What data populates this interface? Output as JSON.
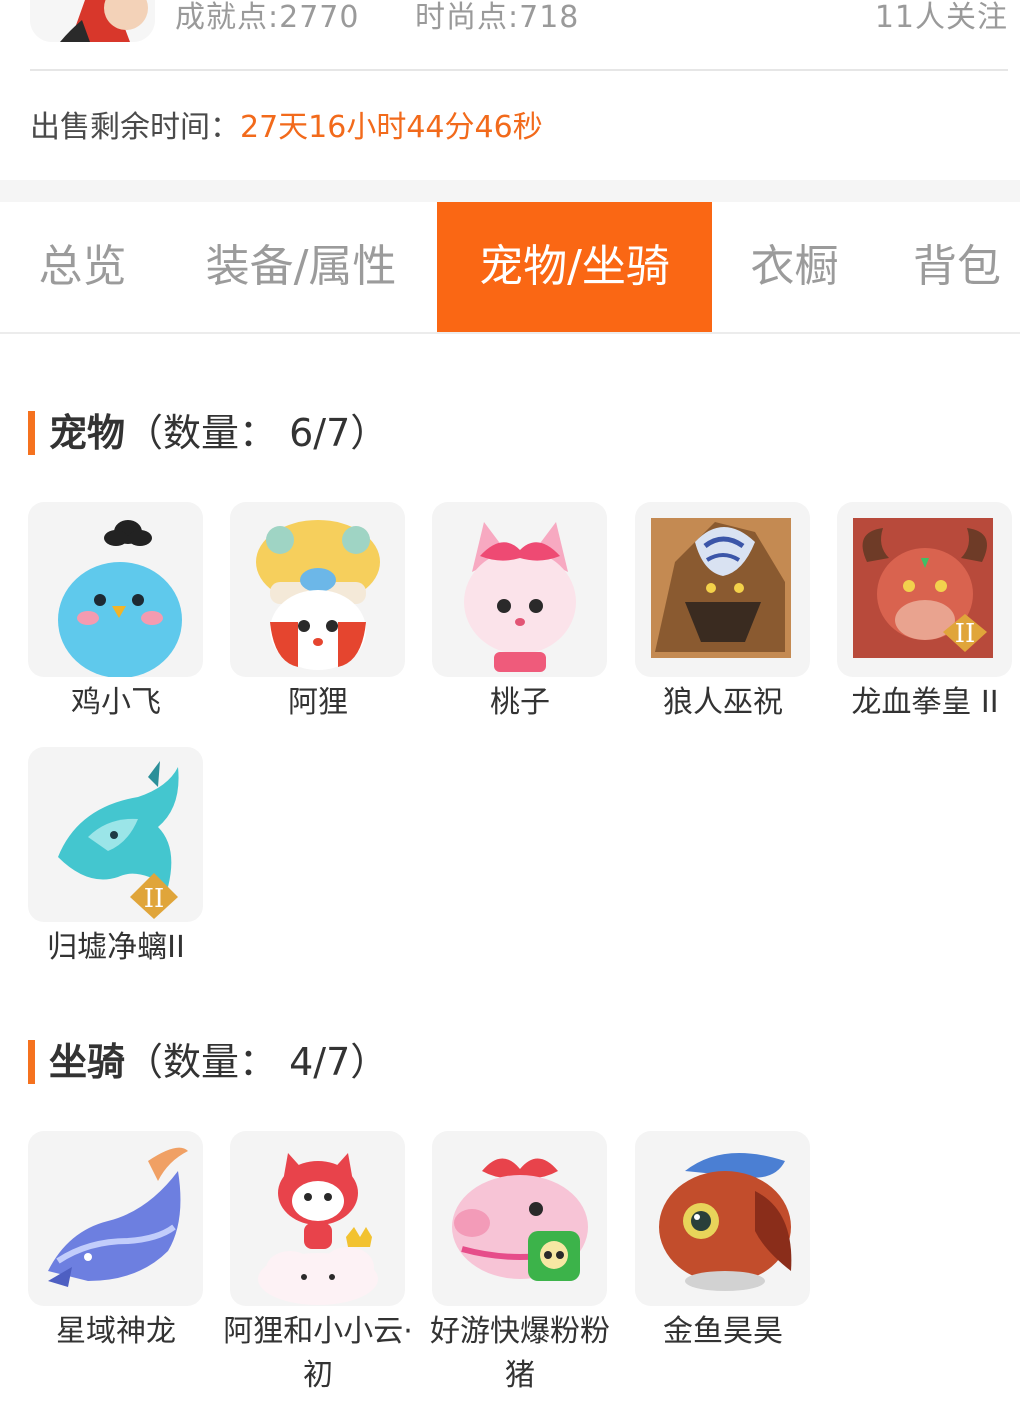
{
  "header": {
    "achievement": "成就点:2770",
    "fashion": "时尚点:718",
    "followers": "11人关注"
  },
  "sale": {
    "label": "出售剩余时间：",
    "value": "27天16小时44分46秒"
  },
  "tabs": [
    {
      "label": "总览"
    },
    {
      "label": "装备/属性"
    },
    {
      "label": "宠物/坐骑"
    },
    {
      "label": "衣橱"
    },
    {
      "label": "背包"
    }
  ],
  "active_tab": "宠物/坐骑",
  "pets": {
    "title": "宠物",
    "count": "（数量：  6/7）",
    "items": [
      {
        "name": "鸡小飞",
        "icon": "blue-chick-pet-icon"
      },
      {
        "name": "阿狸",
        "icon": "ali-lion-hat-pet-icon"
      },
      {
        "name": "桃子",
        "icon": "peach-fox-pet-icon"
      },
      {
        "name": "狼人巫祝",
        "icon": "werewolf-shaman-pet-icon"
      },
      {
        "name": "龙血拳皇 II",
        "icon": "dragon-blood-boxer-pet-icon"
      },
      {
        "name": "归墟净螭II",
        "icon": "cyan-dragon-pet-icon"
      }
    ]
  },
  "mounts": {
    "title": "坐骑",
    "count": "（数量：  4/7）",
    "items": [
      {
        "name": "星域神龙",
        "icon": "star-dragon-mount-icon"
      },
      {
        "name": "阿狸和小小云·初",
        "icon": "ali-cloud-mount-icon"
      },
      {
        "name": "好游快爆粉粉猪",
        "icon": "pink-pig-mount-icon"
      },
      {
        "name": "金鱼昊昊",
        "icon": "goldfish-mount-icon"
      }
    ]
  },
  "colors": {
    "accent": "#fa6714",
    "countdown": "#f26a1b"
  }
}
